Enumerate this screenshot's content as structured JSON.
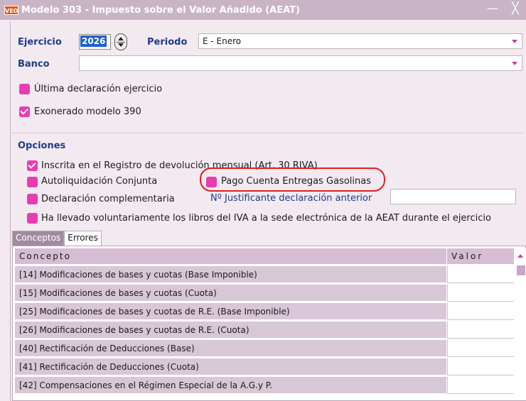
{
  "window": {
    "logo": "VEO",
    "title": "Modelo 303 - Impuesto sobre el Valor Añadido (AEAT)",
    "minimize": "—",
    "close": "╳"
  },
  "form": {
    "ejercicio_label": "Ejercicio",
    "ejercicio_value": "2026",
    "periodo_label": "Periodo",
    "periodo_value": "E - Enero",
    "banco_label": "Banco",
    "banco_value": "",
    "ultima_declaracion": "Última declaración ejercicio",
    "exonerado": "Exonerado modelo 390"
  },
  "opciones": {
    "title": "Opciones",
    "inscrita": "Inscrita en el Registro de devolución mensual (Art. 30 RIVA)",
    "autoliquidacion": "Autoliquidación Conjunta",
    "pago_cuenta": "Pago Cuenta Entregas Gasolinas",
    "complementaria": "Declaración complementaria",
    "justificante_label": "Nº Justificante declaración anterior",
    "justificante_value": "",
    "libros_iva": "Ha llevado voluntariamente los libros del IVA a la sede electrónica de la AEAT durante el ejercicio"
  },
  "checks": {
    "ultima": false,
    "exonerado": true,
    "inscrita": true,
    "autoliquidacion": false,
    "pago_cuenta": false,
    "complementaria": false,
    "libros_iva": false
  },
  "tabs": [
    {
      "label": "Conceptos"
    },
    {
      "label": "Errores"
    }
  ],
  "grid": {
    "col_concepto": "Concepto",
    "col_valor": "Valor",
    "rows": [
      {
        "concepto": "[14] Modificaciones de bases y cuotas (Base Imponible)",
        "valor": ""
      },
      {
        "concepto": "[15] Modificaciones de bases y cuotas (Cuota)",
        "valor": ""
      },
      {
        "concepto": "[25] Modificaciones de bases y cuotas de R.E. (Base Imponible)",
        "valor": ""
      },
      {
        "concepto": "[26] Modificaciones de bases y cuotas de R.E. (Cuota)",
        "valor": ""
      },
      {
        "concepto": "[40] Rectificación de Deducciones (Base)",
        "valor": ""
      },
      {
        "concepto": "[41] Rectificación de Deducciones (Cuota)",
        "valor": ""
      },
      {
        "concepto": "[42] Compensaciones en el Régimen Especial de la A.G.y P.",
        "valor": ""
      }
    ]
  },
  "colors": {
    "checkbox": "#e83cb0",
    "highlight": "#e0201c",
    "label": "#1e3c87",
    "titlebar": "#c8b4c4"
  }
}
